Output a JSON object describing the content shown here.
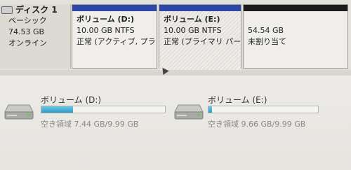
{
  "disk": {
    "title": "ディスク 1",
    "type": "ベーシック",
    "size": "74.53 GB",
    "status": "オンライン"
  },
  "partitions": [
    {
      "name": "ボリューム (D:)",
      "size_fs": "10.00 GB NTFS",
      "status": "正常 (アクティブ, プラ",
      "bar_color": "#2d48a6"
    },
    {
      "name": "ボリューム (E:)",
      "size_fs": "10.00 GB NTFS",
      "status": "正常 (プライマリ パー",
      "bar_color": "#2d48a6"
    },
    {
      "name": "",
      "size_fs": "54.54 GB",
      "status": "未割り当て",
      "bar_color": "#1c1c1c"
    }
  ],
  "volumes": [
    {
      "name": "ボリューム (D:)",
      "free_text": "空き領域 7.44 GB/9.99 GB",
      "used_fraction": 0.255
    },
    {
      "name": "ボリューム (E:)",
      "free_text": "空き領域 9.66 GB/9.99 GB",
      "used_fraction": 0.033
    }
  ],
  "icons": {
    "disk": "disk-icon",
    "drive": "hard-drive-icon",
    "pointer": "mouse-pointer-icon"
  }
}
